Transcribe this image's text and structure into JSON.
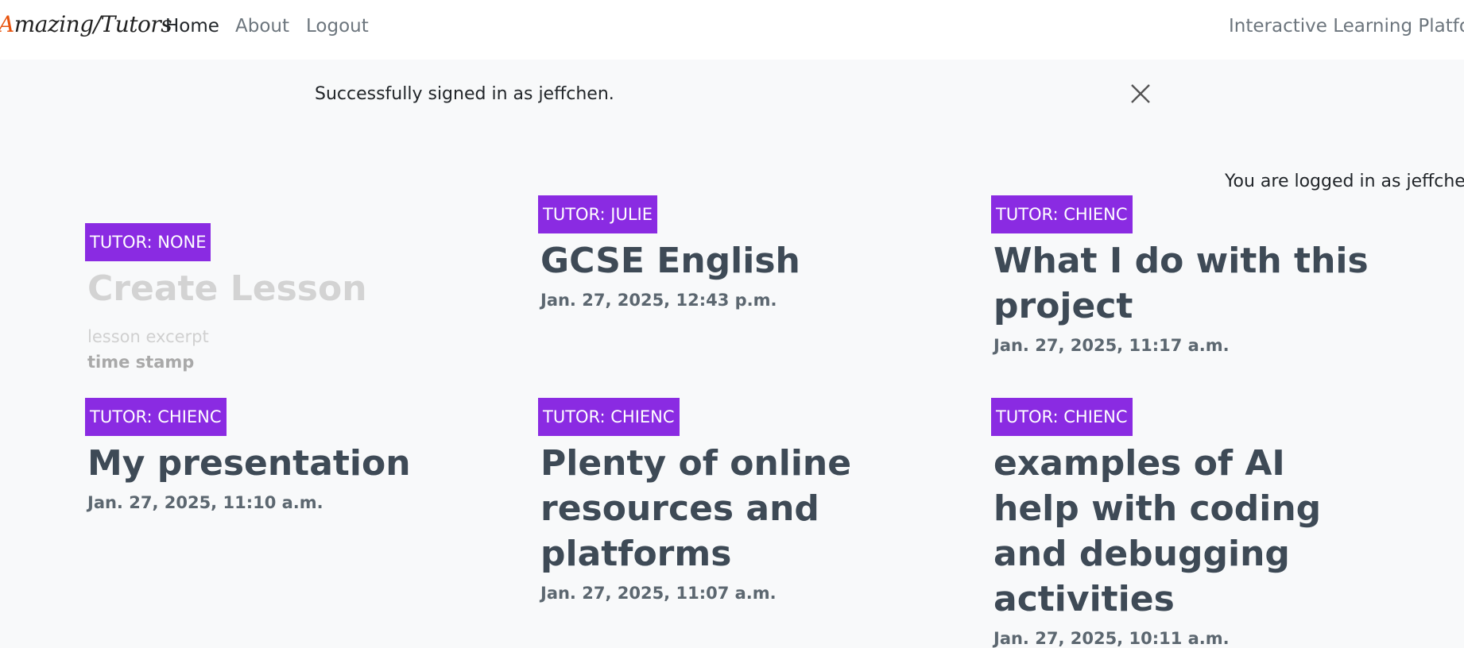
{
  "navbar": {
    "brand": {
      "first": "A",
      "rest": "mazing/Tutors"
    },
    "links": [
      "Home",
      "About",
      "Logout"
    ],
    "tagline": "Interactive Learning Platform"
  },
  "alert": {
    "message": "Successfully signed in as jeffchen.",
    "close_icon": "close-icon"
  },
  "user_status": "You are logged in as jeffchen",
  "placeholder_card": {
    "badge": "TUTOR: NONE",
    "title": "Create Lesson",
    "excerpt": "lesson excerpt",
    "timestamp": "time stamp"
  },
  "lessons": [
    {
      "badge": "TUTOR: JULIE",
      "title": "GCSE English",
      "date": "Jan. 27, 2025, 12:43 p.m."
    },
    {
      "badge": "TUTOR: CHIENC",
      "title": "What I do with this project",
      "date": "Jan. 27, 2025, 11:17 a.m."
    },
    {
      "badge": "TUTOR: CHIENC",
      "title": "My presentation",
      "date": "Jan. 27, 2025, 11:10 a.m."
    },
    {
      "badge": "TUTOR: CHIENC",
      "title": "Plenty of online resources and platforms",
      "date": "Jan. 27, 2025, 11:07 a.m."
    },
    {
      "badge": "TUTOR: CHIENC",
      "title": "examples of AI help with coding and debugging activities",
      "date": "Jan. 27, 2025, 10:11 a.m."
    }
  ],
  "colors": {
    "badge": "#8a2be2",
    "brand_accent": "#e8540f",
    "page_background": "#f8f9fa"
  }
}
